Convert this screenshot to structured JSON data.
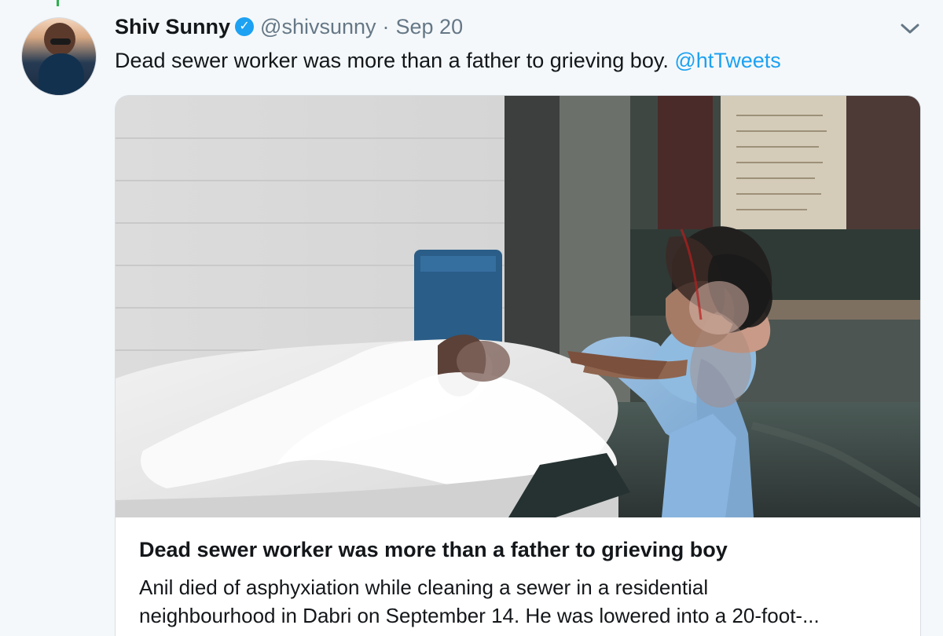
{
  "tweet": {
    "author": {
      "display_name": "Shiv Sunny",
      "handle": "@shivsunny",
      "verified": true,
      "avatar_icon": "user-avatar"
    },
    "separator": "·",
    "date": "Sep 20",
    "text_before_mention": "Dead sewer worker was more than a father to grieving boy. ",
    "mention": "@htTweets",
    "menu_icon": "chevron-down-icon"
  },
  "card": {
    "title": "Dead sewer worker was more than a father to grieving boy",
    "description_line_1": "Anil died of asphyxiation while cleaning a sewer in a residential",
    "description_line_2": "neighbourhood in Dabri on September 14. He was lowered into a 20-foot-..."
  },
  "colors": {
    "background": "#f5f8fa",
    "text": "#14171a",
    "secondary": "#657786",
    "mention": "#1da1f2",
    "verified": "#1da1f2"
  }
}
